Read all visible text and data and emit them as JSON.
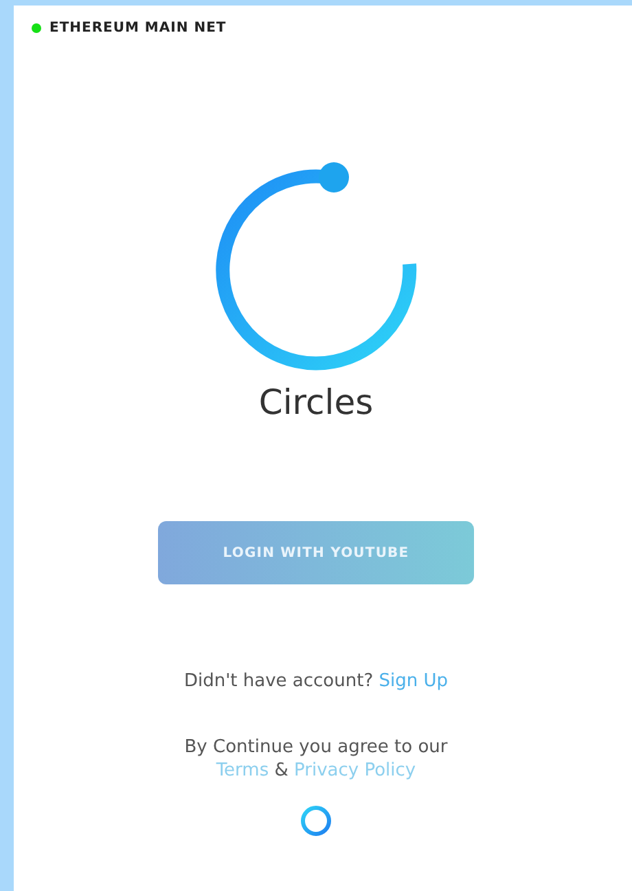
{
  "network": {
    "label": "ETHEREUM MAIN NET"
  },
  "app": {
    "title": "Circles"
  },
  "login_button": {
    "label": "LOGIN WITH YOUTUBE"
  },
  "signup": {
    "text": "Didn't have account?",
    "link": "Sign Up"
  },
  "legal": {
    "text": "By Continue you agree to our",
    "terms_link": "Terms",
    "joiner": "&",
    "privacy_link": "Privacy Policy"
  }
}
